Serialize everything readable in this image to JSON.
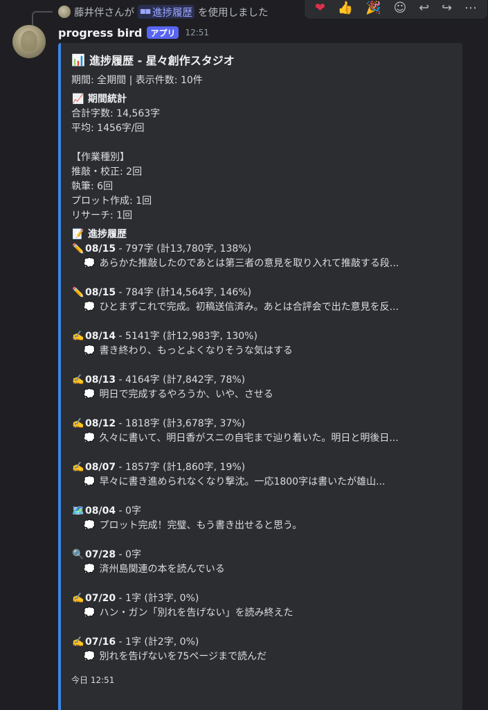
{
  "reply": {
    "user_name": "藤井伴",
    "prefix_suffix": "さんが",
    "command": "進捗履歴",
    "suffix": "を使用しました"
  },
  "reactions": [
    "❤",
    "👍",
    "🎉",
    "☺",
    "↩",
    "↪",
    "⋯"
  ],
  "message": {
    "username": "progress bird",
    "badge": "アプリ",
    "time": "12:51"
  },
  "embed": {
    "title_icon": "📊",
    "title": "進捗履歴 - 星々創作スタジオ",
    "description": "期間: 全期間 | 表示件数: 10件",
    "stats": {
      "icon": "📈",
      "title": "期間統計",
      "total": "合計字数: 14,563字",
      "average": "平均: 1456字/回",
      "category_header": "【作業種別】",
      "categories": [
        "推敲・校正: 2回",
        "執筆: 6回",
        "プロット作成: 1回",
        "リサーチ: 1回"
      ]
    },
    "history": {
      "icon": "📝",
      "title": "進捗履歴",
      "entries": [
        {
          "icon": "✏️",
          "date": "08/15",
          "detail": " - 797字 (計13,780字, 138%)",
          "note": "あらかた推敲したのであとは第三者の意見を取り入れて推敲する段..."
        },
        {
          "icon": "✏️",
          "date": "08/15",
          "detail": " - 784字 (計14,564字, 146%)",
          "note": "ひとまずこれで完成。初稿送信済み。あとは合評会で出た意見を反..."
        },
        {
          "icon": "✍️",
          "date": "08/14",
          "detail": " - 5141字 (計12,983字, 130%)",
          "note": "書き終わり、もっとよくなりそうな気はする"
        },
        {
          "icon": "✍️",
          "date": "08/13",
          "detail": " - 4164字 (計7,842字, 78%)",
          "note": "明日で完成するやろうか、いや、させる"
        },
        {
          "icon": "✍️",
          "date": "08/12",
          "detail": " - 1818字 (計3,678字, 37%)",
          "note": "久々に書いて、明日香がスニの自宅まで辿り着いた。明日と明後日..."
        },
        {
          "icon": "✍️",
          "date": "08/07",
          "detail": " - 1857字 (計1,860字, 19%)",
          "note": "早々に書き進められなくなり撃沈。一応1800字は書いたが雄山..."
        },
        {
          "icon": "🗺️",
          "date": "08/04",
          "detail": " - 0字",
          "note": "プロット完成！完璧、もう書き出せると思う。"
        },
        {
          "icon": "🔍",
          "date": "07/28",
          "detail": " - 0字",
          "note": "済州島関連の本を読んでいる"
        },
        {
          "icon": "✍️",
          "date": "07/20",
          "detail": " - 1字 (計3字, 0%)",
          "note": "ハン・ガン「別れを告げない」を読み終えた"
        },
        {
          "icon": "✍️",
          "date": "07/16",
          "detail": " - 1字 (計2字, 0%)",
          "note": "別れを告げないを75ページまで読んだ"
        }
      ],
      "note_icon": "💭"
    },
    "footer": "今日 12:51"
  }
}
